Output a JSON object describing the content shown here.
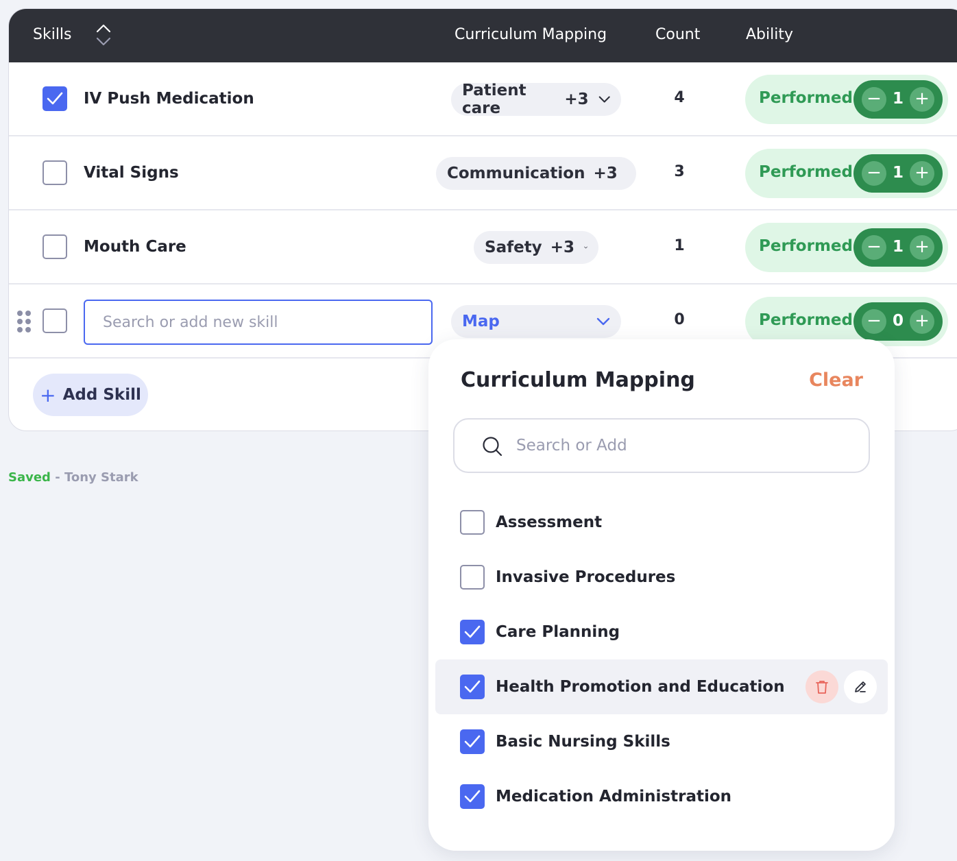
{
  "table": {
    "headers": {
      "skills": "Skills",
      "mapping": "Curriculum Mapping",
      "count": "Count",
      "ability": "Ability"
    },
    "rows": [
      {
        "name": "IV Push Medication",
        "checked": true,
        "mapping": "Patient care",
        "more": "+3",
        "count": "4",
        "ability": "Performed",
        "ability_value": "1"
      },
      {
        "name": "Vital Signs",
        "checked": false,
        "mapping": "Communication",
        "more": "+3",
        "count": "3",
        "ability": "Performed",
        "ability_value": "1"
      },
      {
        "name": "Mouth Care",
        "checked": false,
        "mapping": "Safety",
        "more": "+3",
        "count": "1",
        "ability": "Performed",
        "ability_value": "1"
      }
    ],
    "new_row": {
      "input_placeholder": "Search or add new skill",
      "input_value": "",
      "mapping": "Map",
      "count": "0",
      "ability": "Performed",
      "ability_value": "0"
    },
    "add_skill_label": "Add Skill",
    "stepper_minus": "−",
    "stepper_plus": "+"
  },
  "status": {
    "saved": "Saved",
    "separator": "-",
    "user": "Tony Stark"
  },
  "dropdown": {
    "title": "Curriculum Mapping",
    "clear_label": "Clear",
    "search_placeholder": "Search or Add",
    "options": [
      {
        "label": "Assessment",
        "checked": false
      },
      {
        "label": "Invasive Procedures",
        "checked": false
      },
      {
        "label": "Care Planning",
        "checked": true
      },
      {
        "label": "Health Promotion and Education",
        "checked": true,
        "hovered": true
      },
      {
        "label": "Basic Nursing Skills",
        "checked": true
      },
      {
        "label": "Medication Administration",
        "checked": true
      }
    ]
  },
  "colors": {
    "accent": "#4a68f0",
    "header_bg": "#2f3138",
    "success": "#2d8c4e",
    "success_bg": "#dff6e6",
    "clear": "#e8865e",
    "danger_bg": "#fbd9d6"
  },
  "icons": {
    "sort": "sort-updown-icon",
    "chevron": "chevron-down-icon",
    "check": "check-icon",
    "drag": "drag-handle-icon",
    "search": "search-icon",
    "trash": "trash-icon",
    "edit": "pencil-icon",
    "plus": "plus-icon"
  }
}
